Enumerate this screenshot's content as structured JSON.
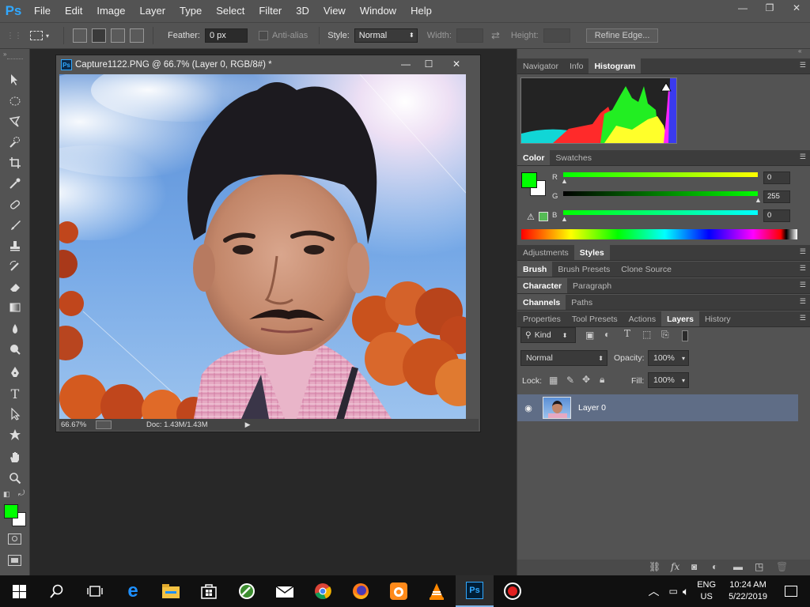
{
  "app": {
    "logo": "Ps",
    "menus": [
      "File",
      "Edit",
      "Image",
      "Layer",
      "Type",
      "Select",
      "Filter",
      "3D",
      "View",
      "Window",
      "Help"
    ],
    "window_controls": {
      "minimize": "—",
      "restore": "❐",
      "close": "✕"
    }
  },
  "options": {
    "feather_label": "Feather:",
    "feather_value": "0 px",
    "antialias_label": "Anti-alias",
    "style_label": "Style:",
    "style_value": "Normal",
    "width_label": "Width:",
    "height_label": "Height:",
    "refine_label": "Refine Edge..."
  },
  "document": {
    "title": "Capture1122.PNG @ 66.7% (Layer 0, RGB/8#) *",
    "zoom": "66.67%",
    "doc_info": "Doc: 1.43M/1.43M",
    "controls": {
      "minimize": "—",
      "restore": "☐",
      "close": "✕"
    }
  },
  "panels": {
    "nav_tabs": [
      "Navigator",
      "Info",
      "Histogram"
    ],
    "color_tabs": [
      "Color",
      "Swatches"
    ],
    "color": {
      "r_label": "R",
      "g_label": "G",
      "b_label": "B",
      "r": "0",
      "g": "255",
      "b": "0"
    },
    "adj_tabs": [
      "Adjustments",
      "Styles"
    ],
    "brush_tabs": [
      "Brush",
      "Brush Presets",
      "Clone Source"
    ],
    "char_tabs": [
      "Character",
      "Paragraph"
    ],
    "chan_tabs": [
      "Channels",
      "Paths"
    ],
    "layer_tabs": [
      "Properties",
      "Tool Presets",
      "Actions",
      "Layers",
      "History"
    ],
    "layers": {
      "kind": "Kind",
      "blend": "Normal",
      "opacity_label": "Opacity:",
      "opacity": "100%",
      "lock_label": "Lock:",
      "fill_label": "Fill:",
      "fill": "100%",
      "layer_name": "Layer 0"
    }
  },
  "colors": {
    "fg": "#00ff00",
    "accent": "#31a8ff",
    "selected_layer": "#5f6d86"
  },
  "taskbar": {
    "lang": "ENG",
    "region": "US",
    "time": "10:24 AM",
    "date": "5/22/2019"
  }
}
